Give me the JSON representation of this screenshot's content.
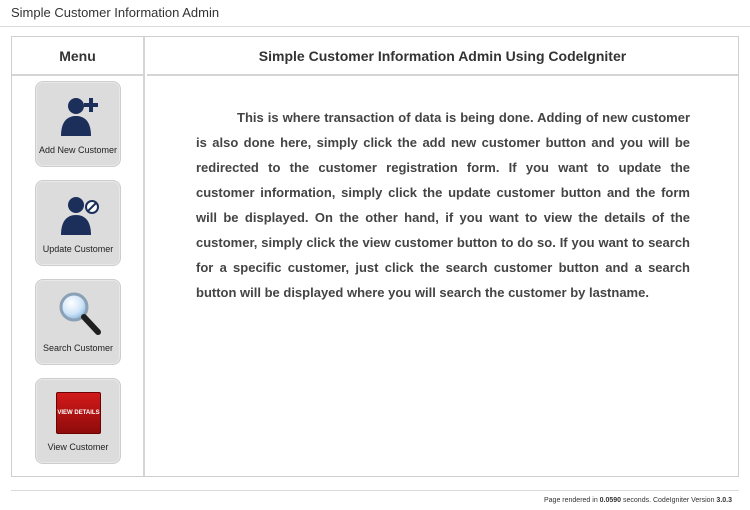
{
  "window": {
    "title": "Simple Customer Information Admin"
  },
  "menu": {
    "heading": "Menu",
    "items": [
      {
        "label": "Add New Customer",
        "icon": "add-user-icon"
      },
      {
        "label": "Update Customer",
        "icon": "edit-user-icon"
      },
      {
        "label": "Search Customer",
        "icon": "magnifier-icon"
      },
      {
        "label": "View Customer",
        "icon": "view-details-icon",
        "icon_text": "VIEW DETAILS"
      }
    ]
  },
  "main": {
    "heading": "Simple Customer Information Admin Using CodeIgniter",
    "paragraph": "This is where transaction of data is being done. Adding of new customer is also done here, simply click the add new customer button and you will be redirected to the customer registration form. If you want to update the customer information, simply click the update customer button and the form will be displayed. On the other hand, if you want to view the details of the customer, simply click the view customer button to do so. If you want to search for a specific customer, just click the search customer button and a search button will be displayed where you will search the customer by lastname."
  },
  "footer": {
    "prefix": "Page rendered in ",
    "time": "0.0590",
    "middle": " seconds. CodeIgniter Version ",
    "version": "3.0.3"
  },
  "colors": {
    "icon_navy": "#1c2f5b",
    "view_red": "#c01414"
  }
}
